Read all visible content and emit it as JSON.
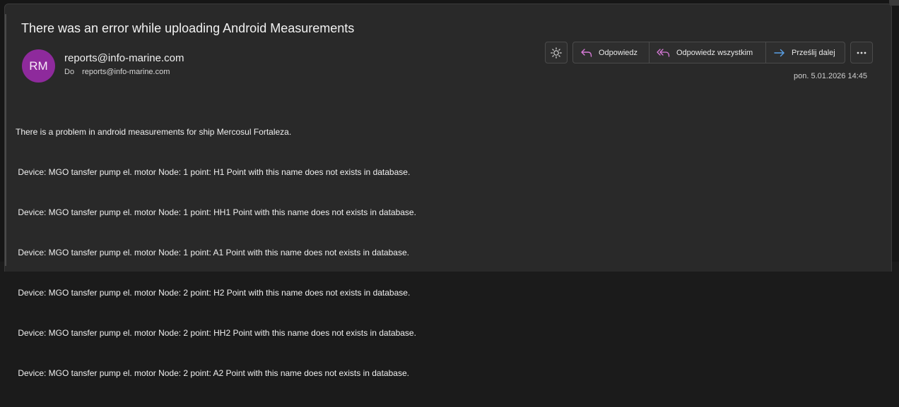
{
  "email": {
    "subject": "There was an error while uploading Android Measurements",
    "avatar_initials": "RM",
    "sender": "reports@info-marine.com",
    "to_label": "Do",
    "to_address": "reports@info-marine.com",
    "date": "pon. 5.01.2026 14:45",
    "body_lines": [
      "There is a problem in android measurements for ship Mercosul Fortaleza.",
      " Device: MGO tansfer pump el. motor Node: 1 point: H1 Point with this name does not exists in database.",
      " Device: MGO tansfer pump el. motor Node: 1 point: HH1 Point with this name does not exists in database.",
      " Device: MGO tansfer pump el. motor Node: 1 point: A1 Point with this name does not exists in database.",
      " Device: MGO tansfer pump el. motor Node: 2 point: H2 Point with this name does not exists in database.",
      " Device: MGO tansfer pump el. motor Node: 2 point: HH2 Point with this name does not exists in database.",
      " Device: MGO tansfer pump el. motor Node: 2 point: A2 Point with this name does not exists in database."
    ]
  },
  "toolbar": {
    "reply_label": "Odpowiedz",
    "reply_all_label": "Odpowiedz wszystkim",
    "forward_label": "Prześlij dalej",
    "theme_icon": "sun-icon",
    "more_icon": "more-icon"
  },
  "colors": {
    "avatar_bg": "#8e2a9c",
    "reply_icon": "#d67ad6",
    "forward_icon": "#5aa0e6",
    "pane_bg": "#292929"
  }
}
